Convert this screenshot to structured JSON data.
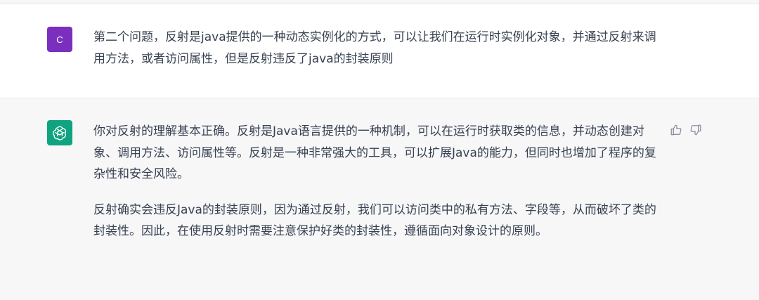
{
  "conversation": {
    "user_message": {
      "avatar_text": "C",
      "text": "第二个问题，反射是java提供的一种动态实例化的方式，可以让我们在运行时实例化对象，并通过反射来调用方法，或者访问属性，但是反射违反了java的封装原则"
    },
    "assistant_message": {
      "paragraphs": [
        "你对反射的理解基本正确。反射是Java语言提供的一种机制，可以在运行时获取类的信息，并动态创建对象、调用方法、访问属性等。反射是一种非常强大的工具，可以扩展Java的能力，但同时也增加了程序的复杂性和安全风险。",
        "反射确实会违反Java的封装原则，因为通过反射，我们可以访问类中的私有方法、字段等，从而破坏了类的封装性。因此，在使用反射时需要注意保护好类的封装性，遵循面向对象设计的原则。"
      ],
      "icons": {
        "avatar": "openai-logo-icon",
        "like": "thumbs-up-icon",
        "dislike": "thumbs-down-icon"
      }
    }
  },
  "colors": {
    "user_avatar": "#7b2fbe",
    "assistant_avatar": "#10a37f",
    "assistant_background": "#f7f7f8",
    "text": "#374151",
    "icon": "#8e8ea0"
  }
}
